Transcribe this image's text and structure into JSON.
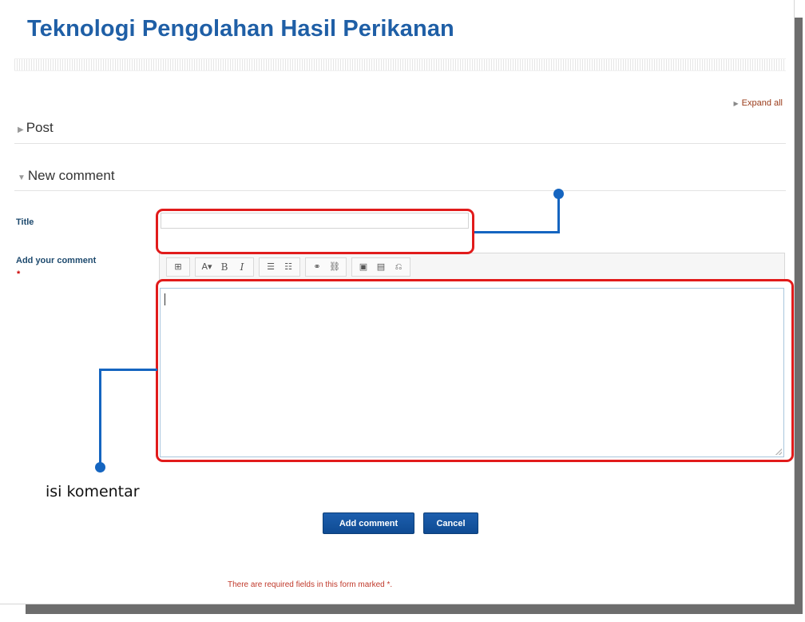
{
  "page": {
    "title": "Teknologi Pengolahan Hasil Perikanan"
  },
  "header": {
    "expand_all": "Expand all"
  },
  "sections": {
    "post": {
      "label": "Post"
    },
    "new_comment": {
      "label": "New comment"
    }
  },
  "form": {
    "title_label": "Title",
    "title_value": "",
    "comment_label": "Add your comment",
    "required_marker": "*",
    "comment_value": ""
  },
  "toolbar": {
    "groups": [
      [
        "⊞"
      ],
      [
        "A▾",
        "B",
        "I"
      ],
      [
        "☰",
        "☷"
      ],
      [
        "⚭",
        "⛓"
      ],
      [
        "▣",
        "▤",
        "⎌"
      ]
    ]
  },
  "annotation": {
    "text": "isi komentar"
  },
  "buttons": {
    "add_comment": "Add comment",
    "cancel": "Cancel"
  },
  "footer": {
    "required_note": "There are required fields in this form marked *."
  },
  "colors": {
    "title": "#1f5fa6",
    "highlight": "#e11b1b",
    "callout": "#1565c0",
    "button": "#1656a3"
  },
  "icons": [
    "expand-triangle-icon",
    "collapse-triangle-icon",
    "resize-grip-icon"
  ]
}
